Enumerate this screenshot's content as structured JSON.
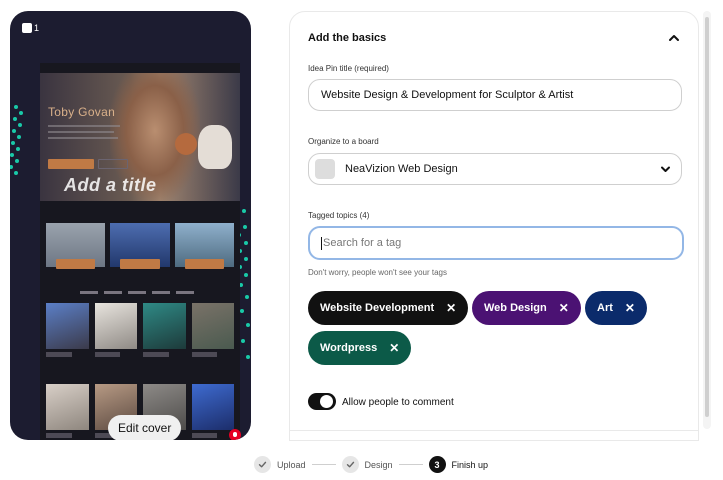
{
  "preview": {
    "page_count": "1",
    "hero_name": "Toby Govan",
    "overlay_title": "Add a title",
    "edit_cover_label": "Edit cover"
  },
  "panel": {
    "section_title": "Add the basics",
    "title_field": {
      "label": "Idea Pin title (required)",
      "value": "Website Design & Development for Sculptor & Artist"
    },
    "board_field": {
      "label": "Organize to a board",
      "value": "NeaVizion Web Design"
    },
    "topics": {
      "label": "Tagged topics (4)",
      "placeholder": "Search for a tag",
      "hint": "Don't worry, people won't see your tags",
      "tags": [
        {
          "label": "Website Development",
          "color": "#111111"
        },
        {
          "label": "Web Design",
          "color": "#4b1273"
        },
        {
          "label": "Art",
          "color": "#0b2b6b"
        },
        {
          "label": "Wordpress",
          "color": "#0c5a48"
        }
      ]
    },
    "comments": {
      "label": "Allow people to comment",
      "enabled": true
    }
  },
  "steps": [
    {
      "label": "Upload",
      "state": "done"
    },
    {
      "label": "Design",
      "state": "done"
    },
    {
      "label": "Finish up",
      "state": "active",
      "number": "3"
    }
  ]
}
